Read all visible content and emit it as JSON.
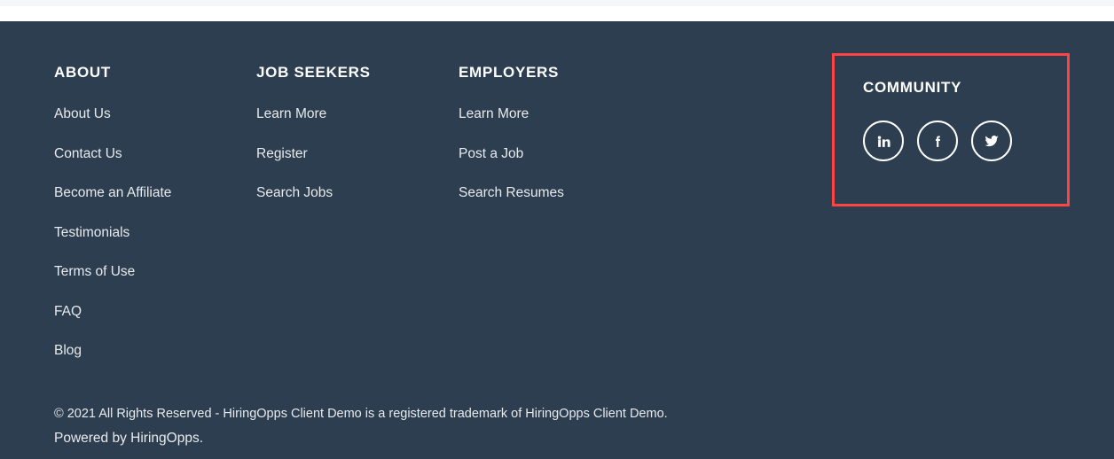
{
  "colors": {
    "footer_background": "#2c3e50",
    "heading_text": "#ffffff",
    "link_text": "#e8eaec",
    "highlight_border": "#ff4444",
    "top_strip": "#f5f6f7",
    "page_background": "#ffffff"
  },
  "footer": {
    "columns": [
      {
        "heading": "ABOUT",
        "links": [
          "About Us",
          "Contact Us",
          "Become an Affiliate",
          "Testimonials",
          "Terms of Use",
          "FAQ",
          "Blog"
        ]
      },
      {
        "heading": "JOB SEEKERS",
        "links": [
          "Learn More",
          "Register",
          "Search Jobs"
        ]
      },
      {
        "heading": "EMPLOYERS",
        "links": [
          "Learn More",
          "Post a Job",
          "Search Resumes"
        ]
      }
    ],
    "community": {
      "heading": "COMMUNITY",
      "social_links": [
        {
          "name": "linkedin",
          "icon": "linkedin-icon",
          "label": "LinkedIn"
        },
        {
          "name": "facebook",
          "icon": "facebook-icon",
          "label": "Facebook"
        },
        {
          "name": "twitter",
          "icon": "twitter-icon",
          "label": "Twitter"
        }
      ]
    },
    "legal": {
      "copyright": "© 2021 All Rights Reserved - HiringOpps Client Demo is a registered trademark of HiringOpps Client Demo.",
      "powered_by_prefix": "Powered by ",
      "powered_by_link": "HiringOpps",
      "powered_by_suffix": "."
    }
  }
}
